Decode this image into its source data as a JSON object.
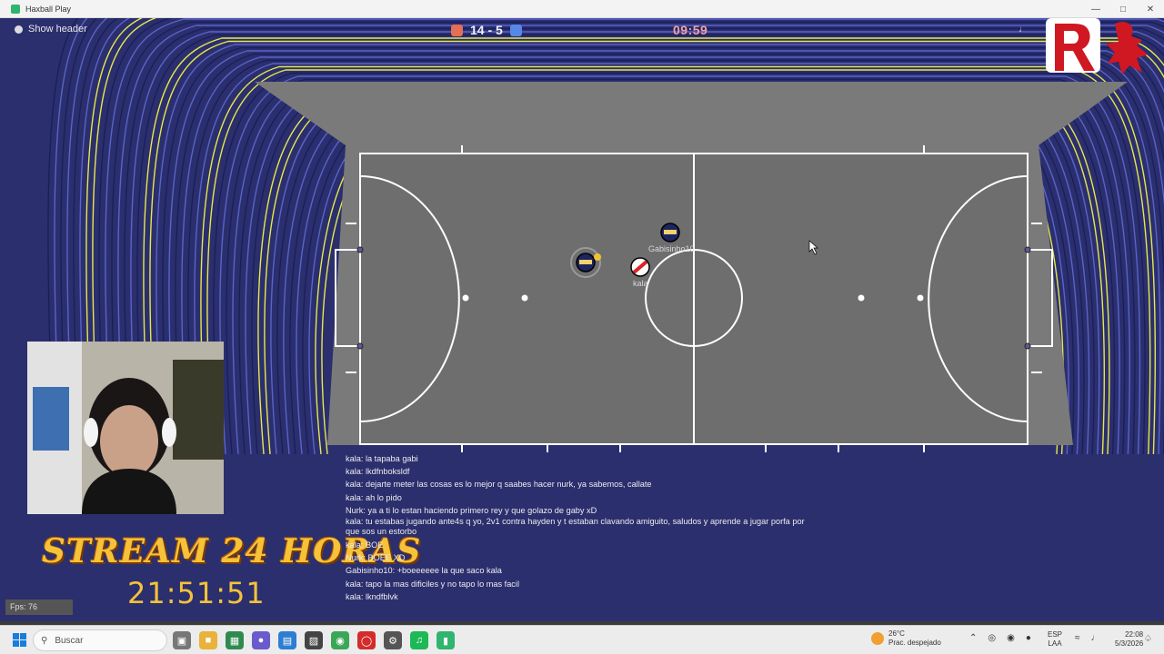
{
  "window": {
    "title": "Haxball Play"
  },
  "game": {
    "show_header_label": "Show header",
    "score": "14 - 5",
    "timer": "09:59",
    "colors": {
      "red_team": "#e56e56",
      "blue_team": "#5689e5",
      "pitch": "#6b6b6b",
      "lines": "#ffffff"
    },
    "players": [
      {
        "name": "Gabisinho10",
        "team": "blue",
        "has_ball_indicator": false
      },
      {
        "name": "",
        "team": "blue",
        "has_ball_indicator": true
      },
      {
        "name": "kala",
        "team": "red",
        "has_ball_indicator": false
      }
    ],
    "fps_label": "Fps: 76"
  },
  "overlay": {
    "stream_title": "STREAM 24 HORAS",
    "stream_clock": "21:51:51"
  },
  "chat": [
    "kala: la tapaba gabi",
    "kala: lkdfnboksldf",
    "kala: dejarte meter las cosas es lo mejor q saabes hacer nurk, ya sabemos, callate",
    "kala: ah lo pido",
    "Nurk: ya a ti lo estan haciendo primero rey y que golazo de gaby xD",
    "kala: tu estabas jugando ante4s q yo, 2v1 contra hayden y t estaban clavando amiguito, saludos y aprende a jugar porfa por que sos un estorbo",
    "kala: BOE",
    "Nurk: BOEE XD",
    "Gabisinho10: +boeeeeee la que saco kala",
    "kala: tapo la mas dificiles y no tapo lo mas facil",
    "kala: lkndfblvk"
  ],
  "taskbar": {
    "search_placeholder": "Buscar",
    "weather_temp": "26°C",
    "weather_desc": "Prac. despejado",
    "lang_1": "ESP",
    "lang_2": "LAA",
    "time": "22:08",
    "date": "5/3/2026"
  }
}
